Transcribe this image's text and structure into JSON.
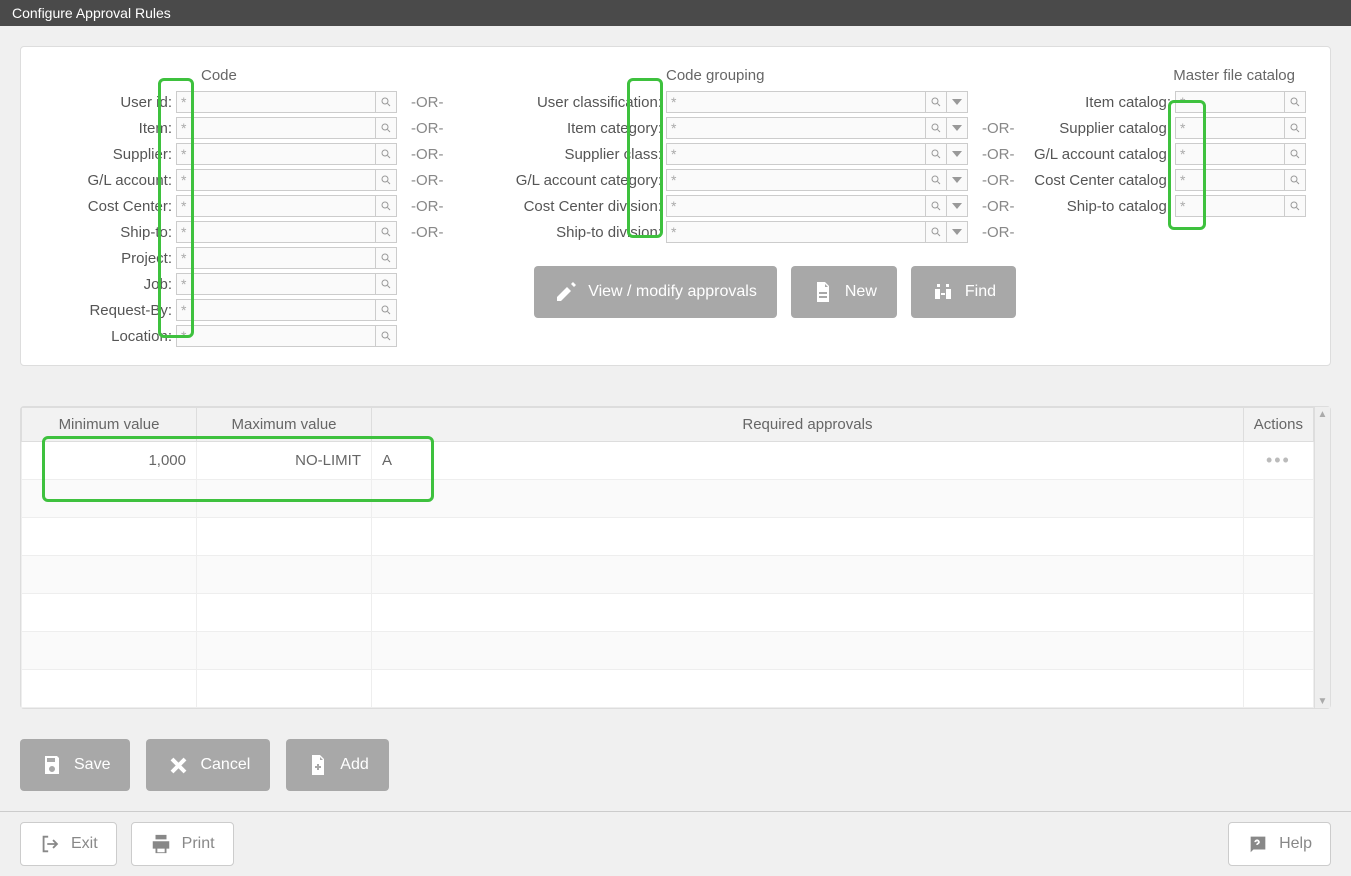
{
  "title": "Configure Approval Rules",
  "headers": {
    "code": "Code",
    "grouping": "Code grouping",
    "catalog": "Master file catalog"
  },
  "or": "-OR-",
  "wild": "*",
  "code_fields": [
    {
      "label": "User id:",
      "or": true
    },
    {
      "label": "Item:",
      "or": true
    },
    {
      "label": "Supplier:",
      "or": true
    },
    {
      "label": "G/L account:",
      "or": true
    },
    {
      "label": "Cost Center:",
      "or": true
    },
    {
      "label": "Ship-to:",
      "or": true
    },
    {
      "label": "Project:",
      "or": false
    },
    {
      "label": "Job:",
      "or": false
    },
    {
      "label": "Request-By:",
      "or": false
    },
    {
      "label": "Location:",
      "or": false
    }
  ],
  "group_fields": [
    {
      "label": "User classification:",
      "or": false
    },
    {
      "label": "Item category:",
      "or": true
    },
    {
      "label": "Supplier class:",
      "or": true
    },
    {
      "label": "G/L account category:",
      "or": true
    },
    {
      "label": "Cost Center division:",
      "or": true
    },
    {
      "label": "Ship-to division:",
      "or": true
    }
  ],
  "catalog_fields": [
    {
      "label": "Item catalog:"
    },
    {
      "label": "Supplier catalog:"
    },
    {
      "label": "G/L account catalog:"
    },
    {
      "label": "Cost Center catalog:"
    },
    {
      "label": "Ship-to catalog:"
    }
  ],
  "buttons": {
    "view_modify": "View / modify approvals",
    "new": "New",
    "find": "Find",
    "save": "Save",
    "cancel": "Cancel",
    "add": "Add",
    "exit": "Exit",
    "print": "Print",
    "help": "Help"
  },
  "table": {
    "headers": {
      "min": "Minimum value",
      "max": "Maximum value",
      "req": "Required approvals",
      "actions": "Actions"
    },
    "rows": [
      {
        "min": "1,000",
        "max": "NO-LIMIT",
        "req": "A"
      }
    ]
  }
}
